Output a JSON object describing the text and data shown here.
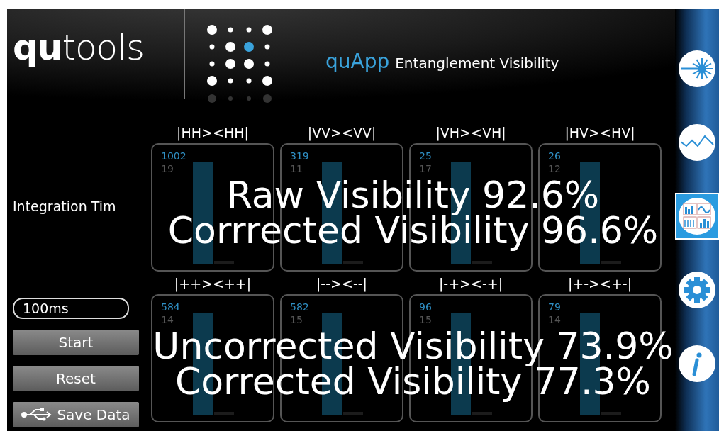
{
  "header": {
    "logo": {
      "bold": "qu",
      "light": "tools"
    },
    "app": "quApp",
    "title": "Entanglement Visibility"
  },
  "controls": {
    "integration_label": "Integration Tim",
    "integration_value": "100ms",
    "buttons": [
      {
        "kind": "plain",
        "label": "Start"
      },
      {
        "kind": "plain",
        "label": "Reset"
      },
      {
        "kind": "usb",
        "label": "Save Data"
      }
    ]
  },
  "rows": [
    {
      "cards": [
        {
          "label": "|HH><HH|",
          "count": "1002",
          "background": "19"
        },
        {
          "label": "|VV><VV|",
          "count": "319",
          "background": "11"
        },
        {
          "label": "|VH><VH|",
          "count": "25",
          "background": "17"
        },
        {
          "label": "|HV><HV|",
          "count": "26",
          "background": "12"
        }
      ],
      "overlay": [
        "Raw Visibility 92.6%",
        "Corrrected Visibility 96.6%"
      ]
    },
    {
      "cards": [
        {
          "label": "|++><++|",
          "count": "584",
          "background": "14"
        },
        {
          "label": "|--><--|",
          "count": "582",
          "background": "15"
        },
        {
          "label": "|-+><-+|",
          "count": "96",
          "background": "15"
        },
        {
          "label": "|+-><+-|",
          "count": "79",
          "background": "14"
        }
      ],
      "overlay": [
        "Uncorrected Visibility 73.9%",
        "Corrected Visibility 77.3%"
      ]
    }
  ],
  "sidebar": [
    {
      "kind": "laser",
      "selected": false
    },
    {
      "kind": "wave",
      "selected": false
    },
    {
      "kind": "dashboard",
      "selected": true
    },
    {
      "kind": "settings",
      "selected": false
    },
    {
      "kind": "info",
      "selected": false
    }
  ]
}
